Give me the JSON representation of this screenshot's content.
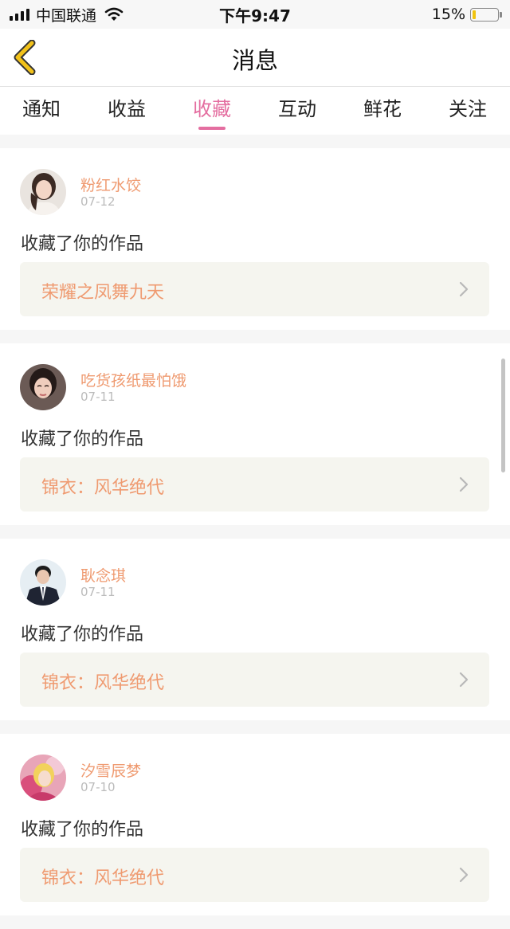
{
  "status_bar": {
    "carrier": "中国联通",
    "time": "下午9:47",
    "battery": "15%",
    "battery_level": 0.15,
    "icons": [
      "signal-icon",
      "wifi-icon",
      "battery-icon"
    ]
  },
  "nav": {
    "title": "消息",
    "back_icon": "chevron-left-icon"
  },
  "tabs": [
    {
      "label": "通知",
      "active": false
    },
    {
      "label": "收益",
      "active": false
    },
    {
      "label": "收藏",
      "active": true
    },
    {
      "label": "互动",
      "active": false
    },
    {
      "label": "鲜花",
      "active": false
    },
    {
      "label": "关注",
      "active": false
    }
  ],
  "items": [
    {
      "name": "粉红水饺",
      "date": "07-12",
      "action": "收藏了你的作品",
      "work": "荣耀之凤舞九天"
    },
    {
      "name": "吃货孩纸最怕饿",
      "date": "07-11",
      "action": "收藏了你的作品",
      "work": "锦衣：风华绝代"
    },
    {
      "name": "耿念琪",
      "date": "07-11",
      "action": "收藏了你的作品",
      "work": "锦衣：风华绝代"
    },
    {
      "name": "汐雪辰梦",
      "date": "07-10",
      "action": "收藏了你的作品",
      "work": "锦衣：风华绝代"
    }
  ],
  "colors": {
    "accent": "#e46ea0",
    "name": "#ef9a70",
    "back": "#f2c21a",
    "work_bg": "#f5f5ef"
  }
}
